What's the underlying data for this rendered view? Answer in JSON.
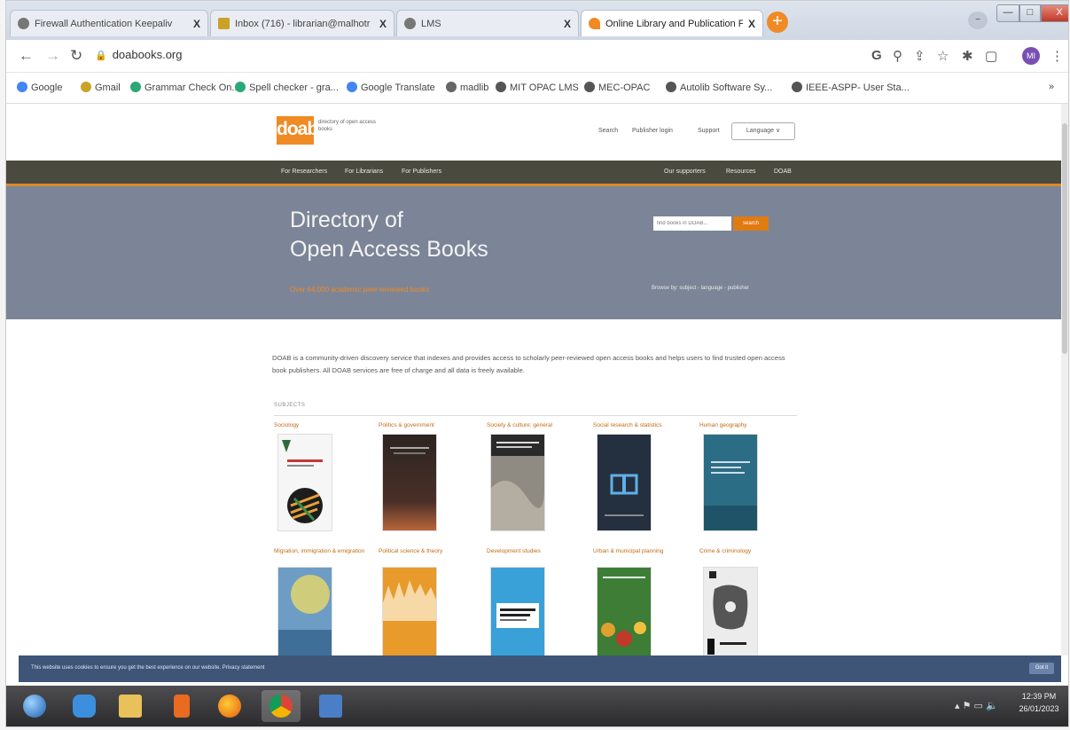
{
  "browser": {
    "tabs": [
      {
        "title": "Firewall Authentication Keepaliv",
        "close": "X",
        "icon": "globe-icon"
      },
      {
        "title": "Inbox (716) - librarian@malhotr",
        "close": "X",
        "icon": "mail-icon"
      },
      {
        "title": "LMS",
        "close": "X",
        "icon": "globe-icon"
      },
      {
        "title": "Online Library and Publication F",
        "close": "X",
        "icon": "doab-favicon",
        "active": true
      }
    ],
    "new_tab": "+",
    "profile_label": "~",
    "window_controls": {
      "minimize": "—",
      "maximize": "□",
      "close": "X"
    },
    "address": "doabooks.org",
    "avatar": "MI"
  },
  "bookmarks": [
    {
      "label": "Google",
      "color": "#4285f4"
    },
    {
      "label": "Gmail",
      "color": "#c9a227"
    },
    {
      "label": "Grammar Check On...",
      "color": "#2aa876"
    },
    {
      "label": "Spell checker - gra...",
      "color": "#2aa876"
    },
    {
      "label": "Google Translate",
      "color": "#4285f4"
    },
    {
      "label": "madlib",
      "color": "#666666"
    },
    {
      "label": "MIT OPAC LMS",
      "color": "#555555"
    },
    {
      "label": "MEC-OPAC",
      "color": "#555555"
    },
    {
      "label": "Autolib Software Sy...",
      "color": "#555555"
    },
    {
      "label": "IEEE-ASPP- User Sta...",
      "color": "#555555"
    }
  ],
  "site": {
    "logo": "doab",
    "logo_tagline": "directory of open access books",
    "topnav": [
      "Search",
      "Publisher login",
      "Support",
      "Language ∨"
    ],
    "mainnav_left": [
      "For Researchers",
      "For Librarians",
      "For Publishers"
    ],
    "mainnav_right": [
      "Our supporters",
      "Resources",
      "DOAB"
    ],
    "hero": {
      "title_line1": "Directory of",
      "title_line2": "Open Access Books",
      "subtitle": "Over 64,000 academic peer-reviewed books",
      "search_placeholder": "find books in DOAB...",
      "search_button": "search",
      "browse": "Browse by: subject - language - publisher"
    },
    "intro": "DOAB is a community-driven discovery service that indexes and provides access to scholarly peer-reviewed open access books and helps users to find trusted open access book publishers. All DOAB services are free of charge and all data is freely available.",
    "subjects_label": "SUBJECTS",
    "categories": [
      {
        "label": "Sociology",
        "cover": "#f4f4f4"
      },
      {
        "label": "Politics & government",
        "cover": "#3a2c2a"
      },
      {
        "label": "Society & culture: general",
        "cover": "#9c9890"
      },
      {
        "label": "Social research & statistics",
        "cover": "#2c3a4e"
      },
      {
        "label": "Human geography",
        "cover": "#2f6f86"
      },
      {
        "label": "Migration, immigration & emigration",
        "cover": "#6d9cc4"
      },
      {
        "label": "Political science & theory",
        "cover": "#e89a2a"
      },
      {
        "label": "Development studies",
        "cover": "#3aa0d8"
      },
      {
        "label": "Urban & municipal planning",
        "cover": "#3d7d35"
      },
      {
        "label": "Crime & criminology",
        "cover": "#e8e8e8"
      }
    ]
  },
  "cookie": {
    "text": "This website uses cookies to ensure you get the best experience on our website. Privacy statement",
    "button": "Got it"
  },
  "taskbar": {
    "apps": [
      "start-orb",
      "internet-explorer-icon",
      "file-explorer-icon",
      "media-player-icon",
      "firefox-icon",
      "chrome-icon",
      "photo-viewer-icon"
    ],
    "clock_time": "12:39 PM",
    "clock_date": "26/01/2023"
  }
}
